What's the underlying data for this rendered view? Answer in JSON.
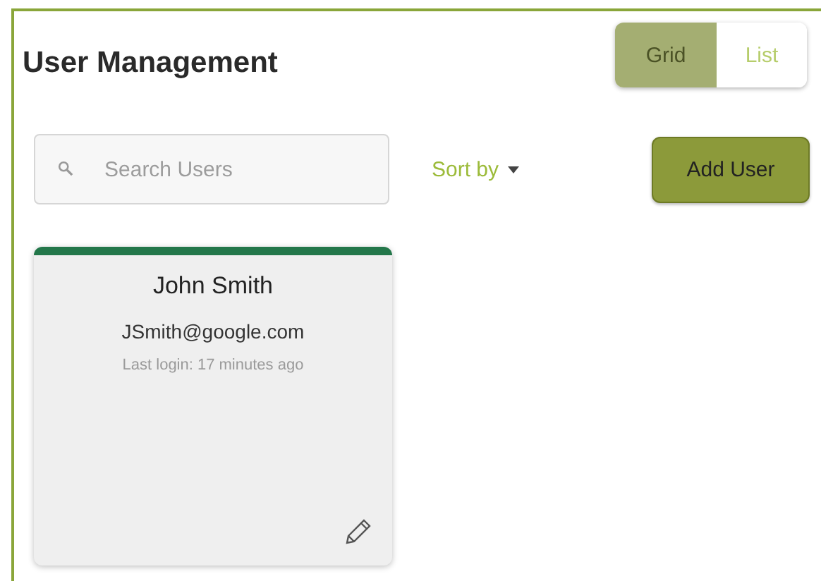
{
  "title": "User Management",
  "view_toggle": [
    {
      "label": "Grid",
      "selected": true
    },
    {
      "label": "List",
      "selected": false
    }
  ],
  "search": {
    "placeholder": "Search Users"
  },
  "sort": {
    "label": "Sort by"
  },
  "add_button": "Add User",
  "users": [
    {
      "name": "John Smith",
      "email": "JSmith@google.com",
      "last_login": "Last login: 17 minutes ago"
    }
  ]
}
